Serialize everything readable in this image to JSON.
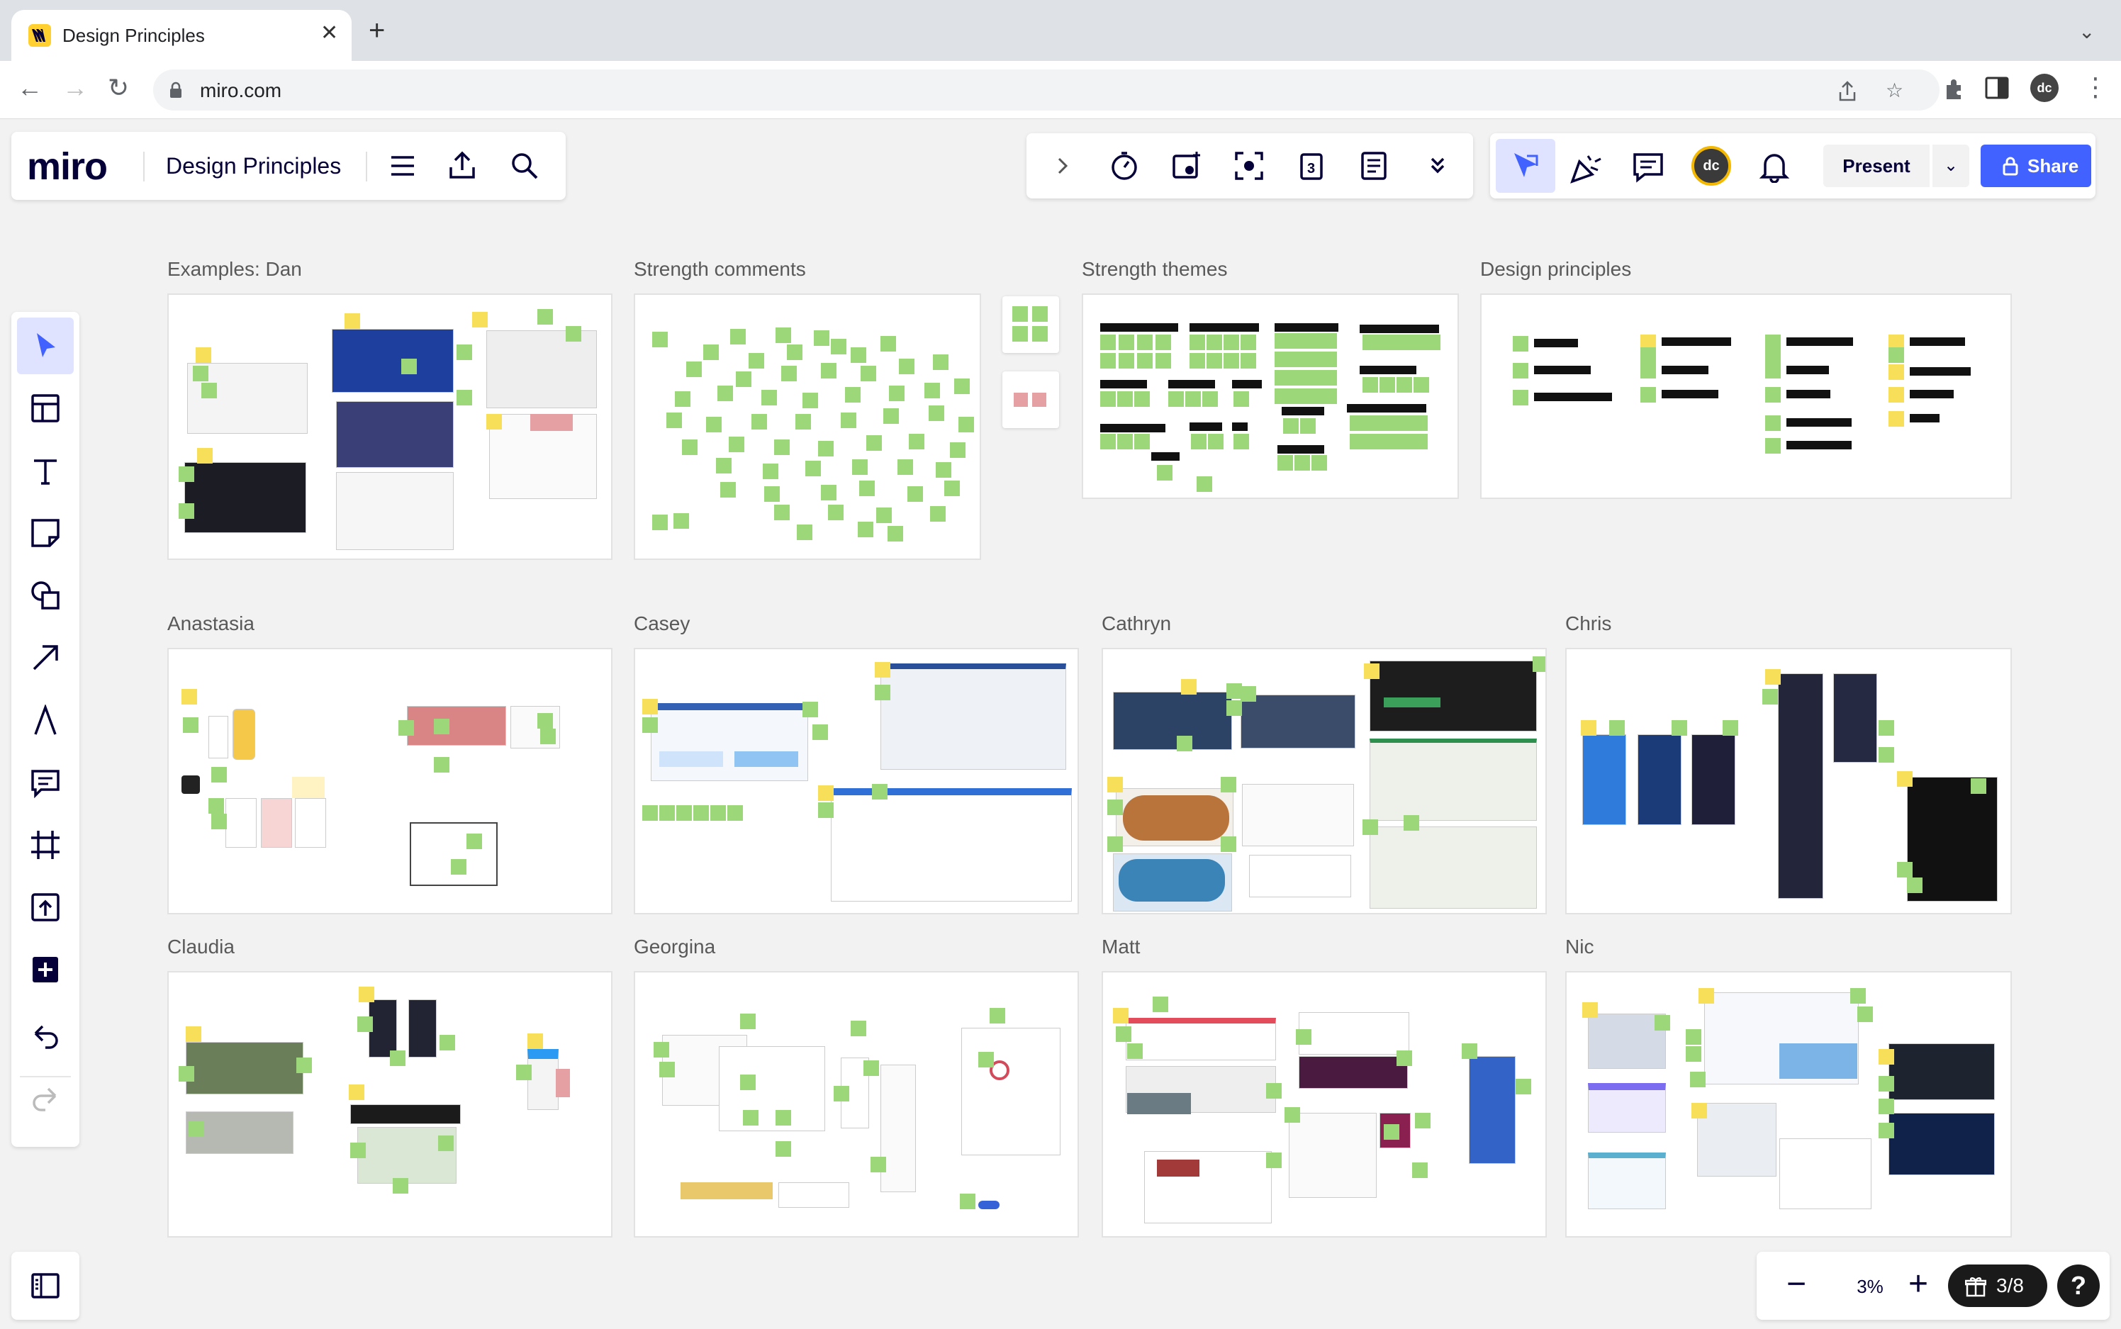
{
  "browser": {
    "tab_title": "Design Principles",
    "url": "miro.com",
    "profile_initials": "dc"
  },
  "miro": {
    "logo": "miro",
    "board_title": "Design Principles",
    "present_label": "Present",
    "share_label": "Share",
    "user_initials": "dc",
    "zoom": "3%",
    "frames_count": "3/8",
    "help": "?",
    "accent_color": "#4262ff"
  },
  "frames": [
    {
      "label": "Examples: Dan"
    },
    {
      "label": "Strength comments"
    },
    {
      "label": "Strength themes"
    },
    {
      "label": "Design principles"
    },
    {
      "label": "Anastasia"
    },
    {
      "label": "Casey"
    },
    {
      "label": "Cathryn"
    },
    {
      "label": "Chris"
    },
    {
      "label": "Claudia"
    },
    {
      "label": "Georgina"
    },
    {
      "label": "Matt"
    },
    {
      "label": "Nic"
    }
  ],
  "icons": {
    "tool_bar": [
      "chevron-right-icon",
      "timer-icon",
      "voting-icon",
      "focus-icon",
      "calendar-icon",
      "notes-icon",
      "more-tools-icon"
    ],
    "collab_bar": [
      "cursor-icon",
      "reactions-icon",
      "comments-icon",
      "bell-icon"
    ],
    "left_toolbar": [
      "select-icon",
      "templates-icon",
      "text-icon",
      "sticky-note-icon",
      "shapes-icon",
      "arrow-icon",
      "pen-icon",
      "comment-icon",
      "frame-icon",
      "upload-icon",
      "add-more-icon",
      "undo-icon",
      "redo-icon"
    ]
  }
}
